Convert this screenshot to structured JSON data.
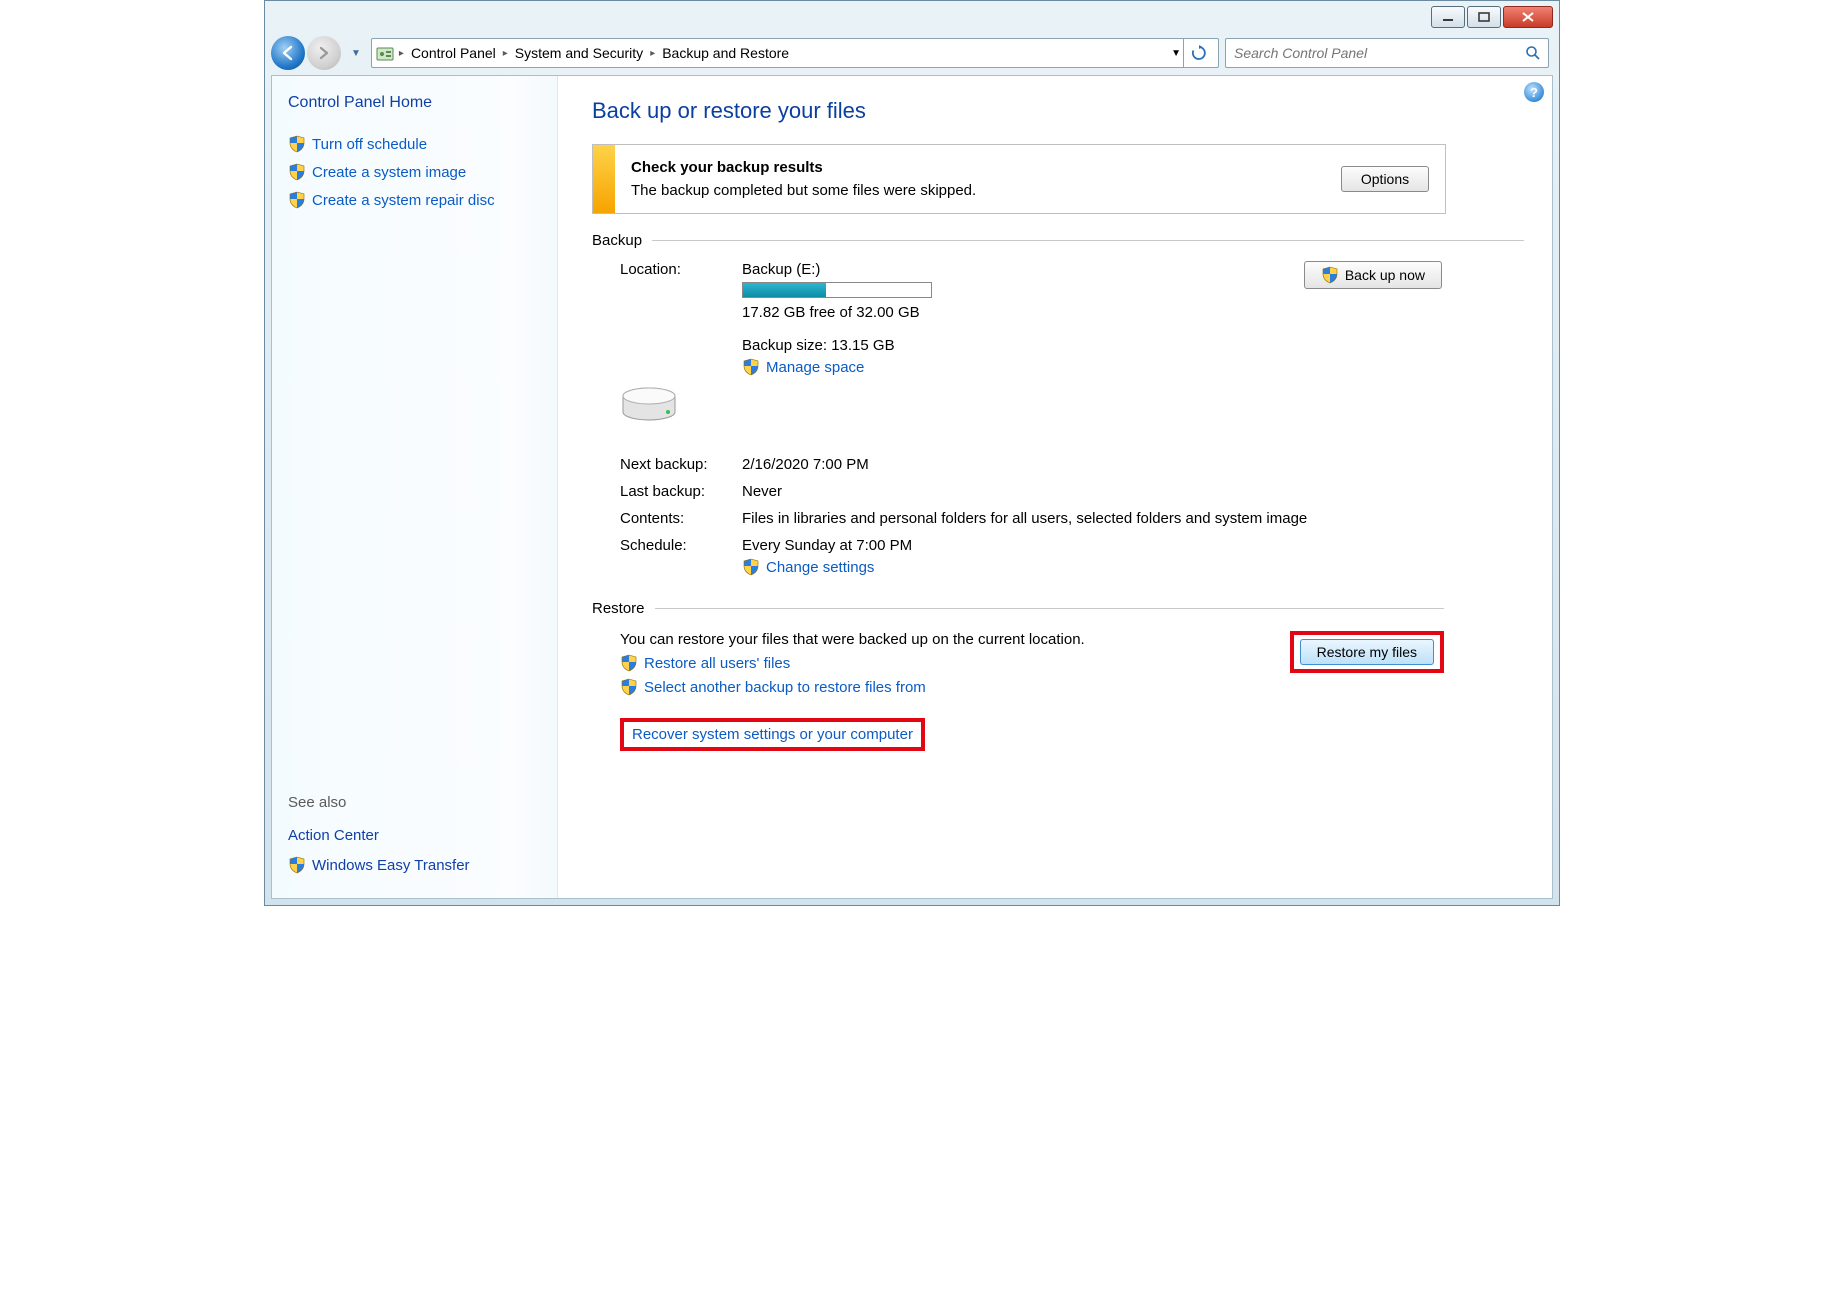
{
  "breadcrumb": {
    "root": "Control Panel",
    "mid": "System and Security",
    "leaf": "Backup and Restore"
  },
  "search": {
    "placeholder": "Search Control Panel"
  },
  "sidebar": {
    "home": "Control Panel Home",
    "links": {
      "turn_off_schedule": "Turn off schedule",
      "create_system_image": "Create a system image",
      "create_repair_disc": "Create a system repair disc"
    },
    "see_also_heading": "See also",
    "action_center": "Action Center",
    "easy_transfer": "Windows Easy Transfer"
  },
  "page": {
    "title": "Back up or restore your files",
    "notice_title": "Check your backup results",
    "notice_body": "The backup completed but some files were skipped.",
    "options_button": "Options"
  },
  "backup": {
    "section": "Backup",
    "location_label": "Location:",
    "location_name": "Backup (E:)",
    "free_space": "17.82 GB free of 32.00 GB",
    "backup_size": "Backup size: 13.15 GB",
    "manage_space": "Manage space",
    "backup_now": "Back up now",
    "next_label": "Next backup:",
    "next_value": "2/16/2020 7:00 PM",
    "last_label": "Last backup:",
    "last_value": "Never",
    "contents_label": "Contents:",
    "contents_value": "Files in libraries and personal folders for all users, selected folders and system image",
    "schedule_label": "Schedule:",
    "schedule_value": "Every Sunday at 7:00 PM",
    "change_settings": "Change settings"
  },
  "restore": {
    "section": "Restore",
    "text": "You can restore your files that were backed up on the current location.",
    "restore_all": "Restore all users' files",
    "select_other": "Select another backup to restore files from",
    "restore_button": "Restore my files",
    "recover_system": "Recover system settings or your computer"
  }
}
